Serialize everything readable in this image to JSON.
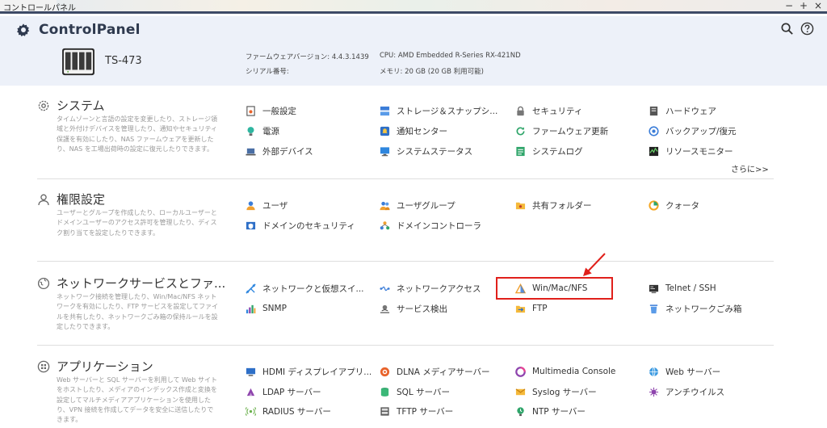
{
  "window": {
    "title": "コントロールパネル",
    "controls": [
      "−",
      "+",
      "×"
    ]
  },
  "header": {
    "app_name": "ControlPanel",
    "model": "TS-473",
    "firmware_label": "ファームウェアバージョン:",
    "firmware_value": "4.4.3.1439",
    "serial_label": "シリアル番号:",
    "cpu_label": "CPU:",
    "cpu_value": "AMD Embedded R-Series RX-421ND",
    "memory_label": "メモリ:",
    "memory_value": "20 GB (20 GB 利用可能)",
    "icons": [
      "search-icon",
      "help-icon"
    ]
  },
  "sections": {
    "system": {
      "title": "システム",
      "description": "タイムゾーンと言語の設定を変更したり、ストレージ領域と外付けデバイスを管理したり、通知やセキュリティ保護を有効にしたり、NAS ファームウェアを更新したり、NAS を工場出荷時の設定に復元したりできます。",
      "items": [
        "一般設定",
        "ストレージ＆スナップシ...",
        "セキュリティ",
        "ハードウェア",
        "電源",
        "通知センター",
        "ファームウェア更新",
        "バックアップ/復元",
        "外部デバイス",
        "システムステータス",
        "システムログ",
        "リソースモニター"
      ],
      "more": "さらに>>"
    },
    "privilege": {
      "title": "権限設定",
      "description": "ユーザーとグループを作成したり、ローカルユーザーとドメインユーザーのアクセス許可を管理したり、ディスク割り当てを設定したりできます。",
      "items": [
        "ユーザ",
        "ユーザグループ",
        "共有フォルダー",
        "クォータ",
        "ドメインのセキュリティ",
        "ドメインコントローラ"
      ]
    },
    "network": {
      "title": "ネットワークサービスとファ...",
      "description": "ネットワーク接続を管理したり、Win/Mac/NFS ネットワークを有効にしたり、FTP サービスを設定してファイルを共有したり、ネットワークごみ箱の保持ルールを設定したりできます。",
      "items": [
        "ネットワークと仮想スイ...",
        "ネットワークアクセス",
        "Win/Mac/NFS",
        "Telnet / SSH",
        "SNMP",
        "サービス検出",
        "FTP",
        "ネットワークごみ箱"
      ]
    },
    "applications": {
      "title": "アプリケーション",
      "description": "Web サーバーと SQL サーバーを利用して Web サイトをホストしたり、メディアのインデックス作成と変換を設定してマルチメディアアプリケーションを使用したり、VPN 接続を作成してデータを安全に送信したりできます。",
      "items": [
        "HDMI ディスプレイアプリ...",
        "DLNA メディアサーバー",
        "Multimedia Console",
        "Web サーバー",
        "LDAP サーバー",
        "SQL サーバー",
        "Syslog サーバー",
        "アンチウイルス",
        "RADIUS サーバー",
        "TFTP サーバー",
        "NTP サーバー"
      ]
    }
  },
  "colors": {
    "highlight_box": "#e0201b",
    "header_bg": "#edf1f9",
    "accent_navy": "#3d4a66"
  }
}
